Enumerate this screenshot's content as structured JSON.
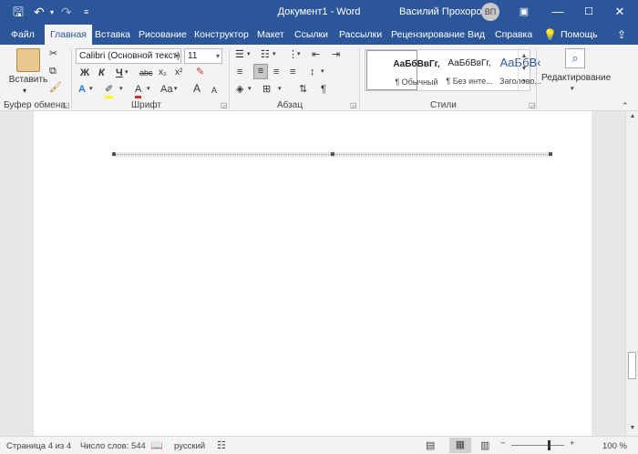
{
  "titlebar": {
    "title": "Документ1 - Word",
    "user": "Василий Прохоров",
    "avatar_initials": "ВП",
    "accent": "#2b579a"
  },
  "tabs": [
    {
      "label": "Файл"
    },
    {
      "label": "Главная"
    },
    {
      "label": "Вставка"
    },
    {
      "label": "Рисование"
    },
    {
      "label": "Конструктор"
    },
    {
      "label": "Макет"
    },
    {
      "label": "Ссылки"
    },
    {
      "label": "Рассылки"
    },
    {
      "label": "Рецензирование"
    },
    {
      "label": "Вид"
    },
    {
      "label": "Справка"
    },
    {
      "label": "Помощь"
    }
  ],
  "ribbon": {
    "clipboard": {
      "paste_label": "Вставить",
      "group": "Буфер обмена"
    },
    "font": {
      "group": "Шрифт",
      "font_name": "Calibri (Основной текст)",
      "font_size": "11",
      "bold": "Ж",
      "italic": "К",
      "underline": "Ч",
      "strike": "abc",
      "subscript": "x₂",
      "superscript": "x²",
      "case": "Aa",
      "grow": "A",
      "shrink": "A"
    },
    "paragraph": {
      "group": "Абзац"
    },
    "styles": {
      "group": "Стили",
      "items": [
        {
          "sample": "АаБбВвГг,",
          "name": "¶ Обычный"
        },
        {
          "sample": "АаБбВвГг,",
          "name": "¶ Без инте..."
        },
        {
          "sample": "АаБбВ‹",
          "name": "Заголово..."
        }
      ]
    },
    "editing": {
      "label": "Редактирование"
    }
  },
  "status": {
    "page": "Страница 4 из 4",
    "words": "Число слов: 544",
    "language": "русский",
    "zoom": "100 %"
  }
}
